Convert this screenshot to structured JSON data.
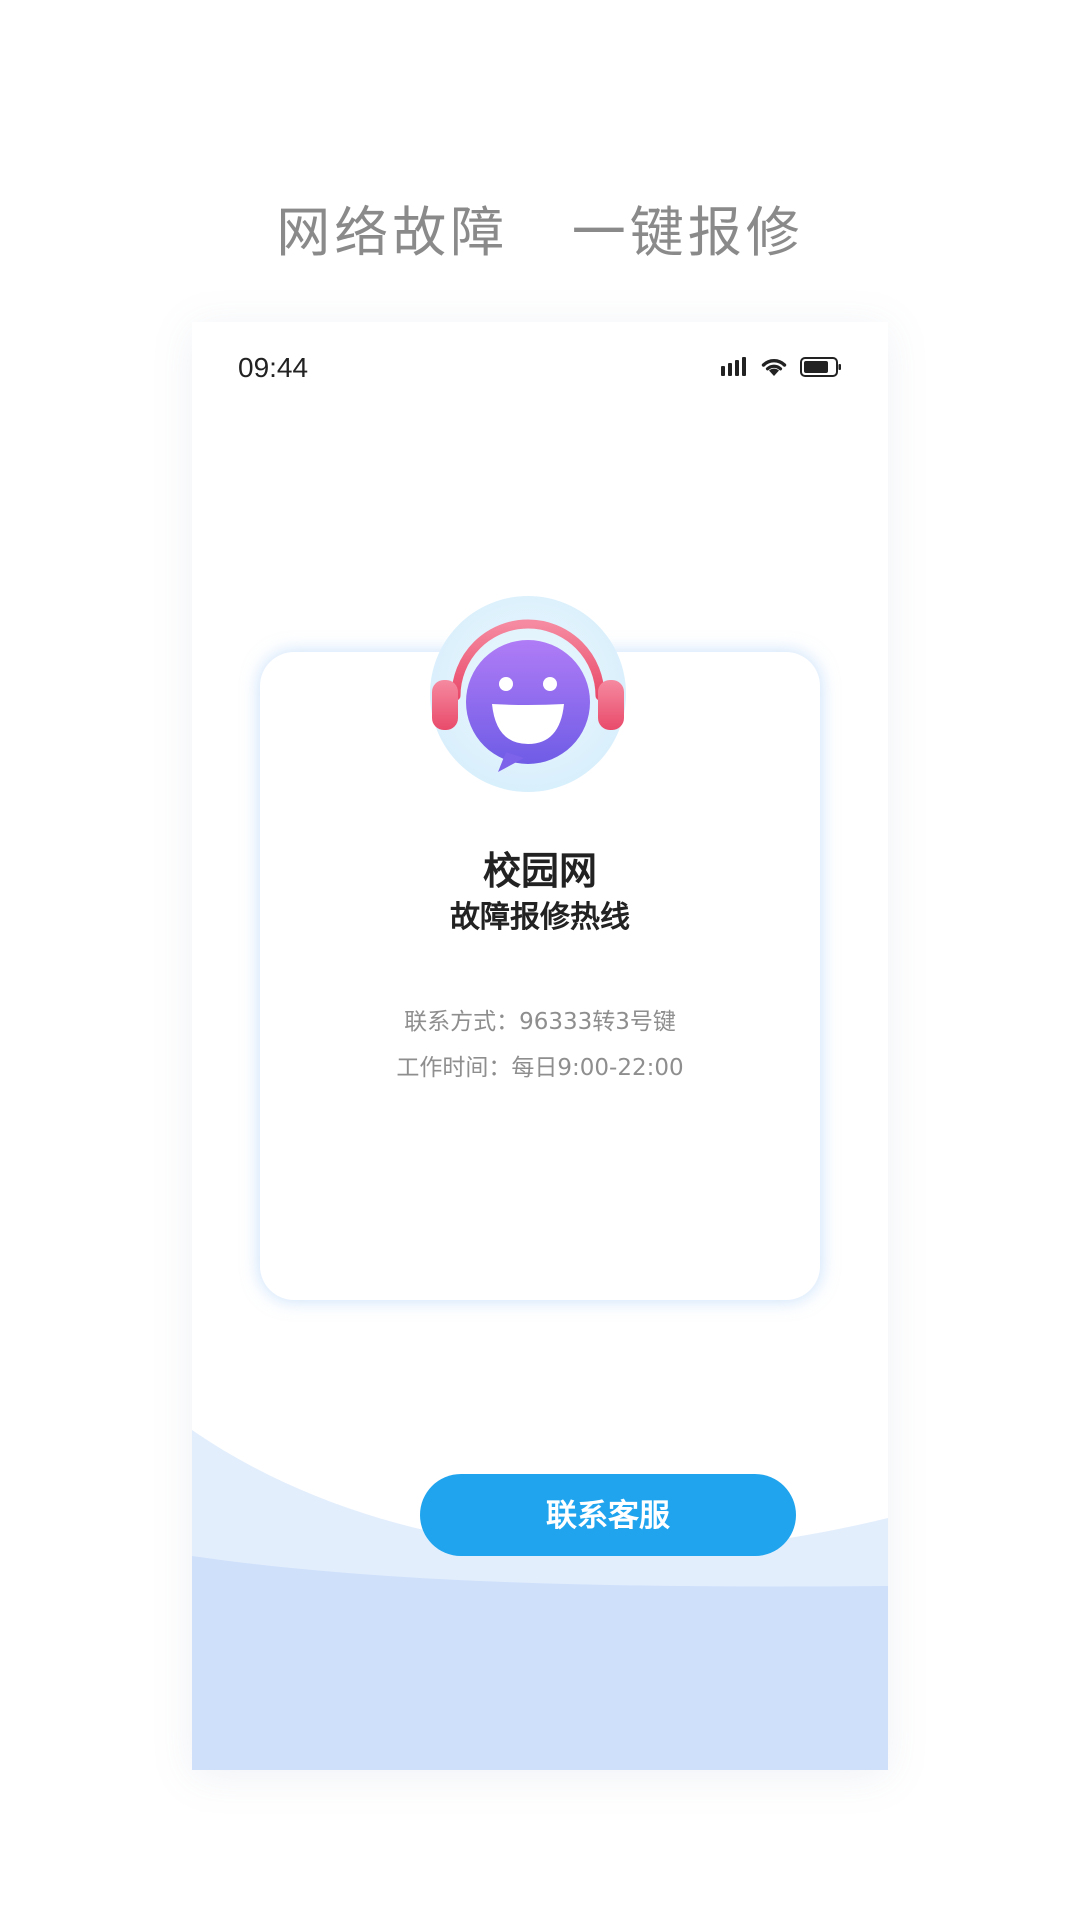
{
  "headline": "网络故障   一键报修",
  "status_bar": {
    "time": "09:44",
    "icons": [
      "signal-icon",
      "wifi-icon",
      "battery-icon"
    ]
  },
  "card": {
    "avatar_icon": "customer-service-icon",
    "title": "校园网",
    "subtitle": "故障报修热线",
    "contact": "联系方式：96333转3号键",
    "hours": "工作时间：每日9:00-22:00",
    "button_label": "联系客服"
  },
  "colors": {
    "accent": "#20a4ee",
    "headline": "#8a8a8a",
    "wave_light": "#e3eefc",
    "wave_dark": "#cfe0fb",
    "avatar_face": "#8f6cf0",
    "headphone": "#f2607e",
    "avatar_bg": "#e5f4fd"
  }
}
